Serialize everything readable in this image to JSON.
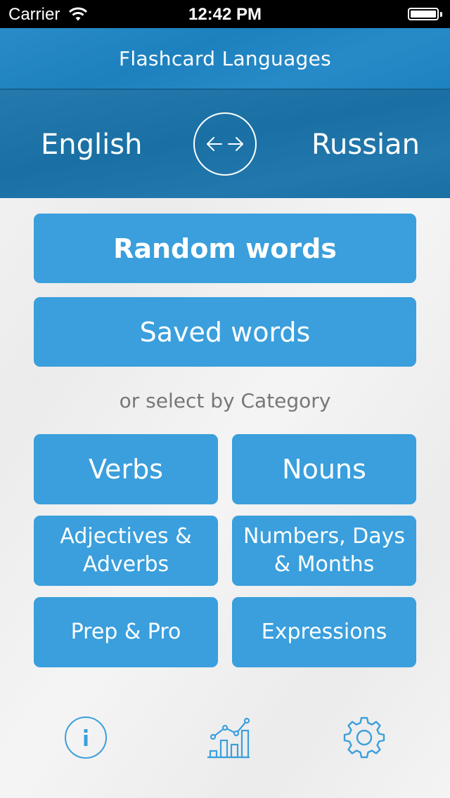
{
  "status_bar": {
    "carrier": "Carrier",
    "time": "12:42 PM",
    "wifi_icon": "wifi-icon",
    "battery_icon": "battery-full-icon"
  },
  "nav": {
    "title": "Flashcard Languages"
  },
  "languages": {
    "source": "English",
    "target": "Russian",
    "swap_icon": "swap-arrows-icon"
  },
  "main": {
    "random_label": "Random words",
    "saved_label": "Saved words",
    "category_prompt": "or select by Category",
    "categories": [
      {
        "label": "Verbs"
      },
      {
        "label": "Nouns"
      },
      {
        "label": "Adjectives & Adverbs"
      },
      {
        "label": "Numbers, Days & Months"
      },
      {
        "label": "Prep & Pro"
      },
      {
        "label": "Expressions"
      }
    ]
  },
  "tab_bar": {
    "items": [
      {
        "icon": "info-icon"
      },
      {
        "icon": "statistics-chart-icon"
      },
      {
        "icon": "gear-icon"
      }
    ]
  },
  "colors": {
    "accent": "#3a9fdc",
    "nav_bg": "#1e86c6",
    "lang_bar_bg": "#1b74aa",
    "icon_color": "#3a9fdc",
    "prompt_text": "#777777"
  }
}
